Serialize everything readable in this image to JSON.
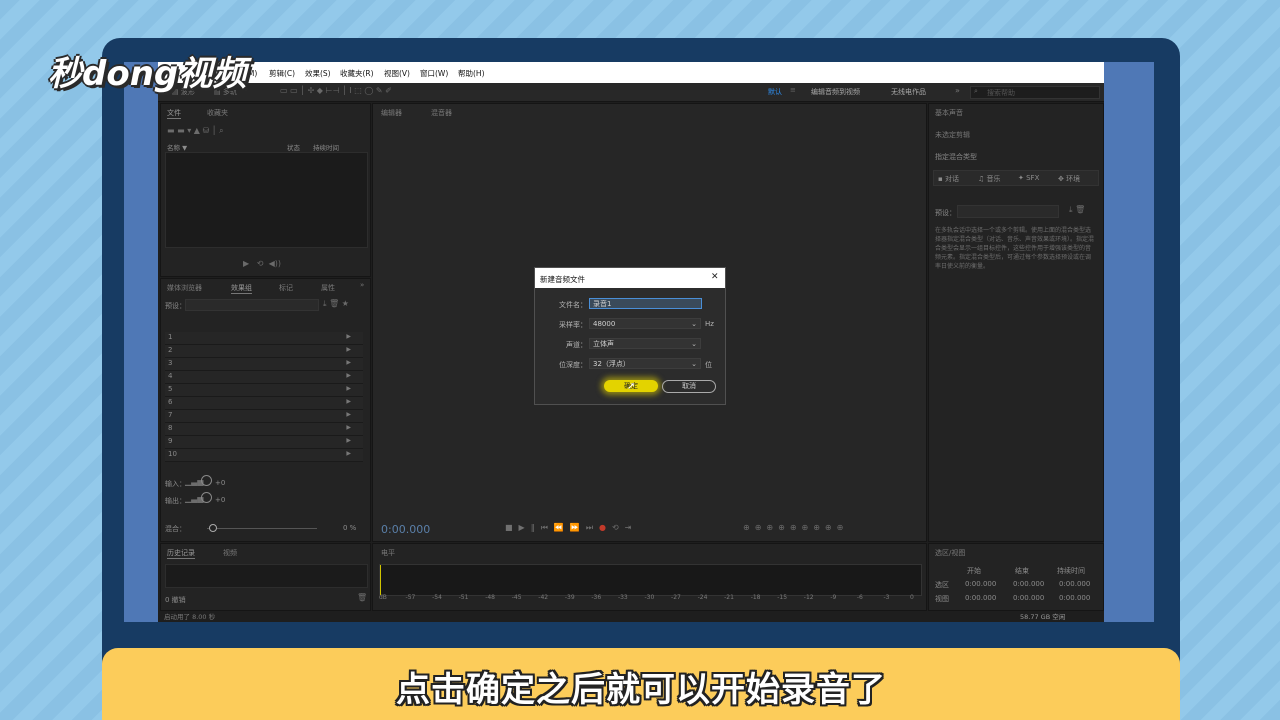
{
  "logo": {
    "text": "秒dong视频"
  },
  "caption": {
    "text": "点击确定之后就可以开始录音了"
  },
  "menubar": {
    "items": [
      "多轨(M)",
      "剪辑(C)",
      "效果(S)",
      "收藏夹(R)",
      "视图(V)",
      "窗口(W)",
      "帮助(H)"
    ]
  },
  "toolbar": {
    "waveform": "波形",
    "multitrack": "多轨",
    "workspaces": [
      "默认",
      "编辑音频到视频",
      "无线电作品"
    ],
    "search_placeholder": "搜索帮助"
  },
  "files_panel": {
    "tabs": [
      "文件",
      "收藏夹"
    ],
    "columns": [
      "名称 ▼",
      "状态",
      "持续时间"
    ]
  },
  "mixer_panel": {
    "tabs": [
      "媒体浏览器",
      "效果组",
      "标记",
      "属性"
    ],
    "preset_label": "预设：",
    "rows": [
      "1",
      "2",
      "3",
      "4",
      "5",
      "6",
      "7",
      "8",
      "9",
      "10"
    ],
    "input_label": "输入：",
    "output_label": "输出：",
    "input_value": "+0",
    "output_value": "+0",
    "mix_label": "混合：",
    "mix_value": "0 %"
  },
  "history_panel": {
    "tabs": [
      "历史记录",
      "视频"
    ],
    "undo": "0 撤销",
    "status": "启动用了 8.00 秒"
  },
  "editor": {
    "tabs": [
      "编辑器",
      "混音器"
    ],
    "time": "0:00.000"
  },
  "levels": {
    "tab": "电平",
    "scale": [
      "dB",
      "-57",
      "-54",
      "-51",
      "-48",
      "-45",
      "-42",
      "-39",
      "-36",
      "-33",
      "-30",
      "-27",
      "-24",
      "-21",
      "-18",
      "-15",
      "-12",
      "-9",
      "-6",
      "-3",
      "0"
    ]
  },
  "essential_sound": {
    "title": "基本声音",
    "no_selection": "未选定剪辑",
    "assign_type": "指定混合类型",
    "types": [
      "对话",
      "音乐",
      "SFX",
      "环境"
    ],
    "preset_label": "预设：",
    "description": "在多轨会话中选择一个或多个剪辑。使用上面的混合类型选择器指定混合类型（对话、音乐、声音效果或环境）。指定混合类型会显示一组目标控件，这些控件用于增强该类型的音频元素。指定混合类型后，可通过每个参数选择预设或在调率日使义前的衡量。"
  },
  "selection_panel": {
    "title": "选区/视图",
    "columns": [
      "开始",
      "结束",
      "持续时间"
    ],
    "rows": [
      {
        "label": "选区",
        "values": [
          "0:00.000",
          "0:00.000",
          "0:00.000"
        ]
      },
      {
        "label": "视图",
        "values": [
          "0:00.000",
          "0:00.000",
          "0:00.000"
        ]
      }
    ],
    "disk_space": "58.77 GB 空闲"
  },
  "dialog": {
    "title": "新建音频文件",
    "filename_label": "文件名：",
    "filename_value": "录音1",
    "samplerate_label": "采样率：",
    "samplerate_value": "48000",
    "samplerate_unit": "Hz",
    "channels_label": "声道：",
    "channels_value": "立体声",
    "bitdepth_label": "位深度：",
    "bitdepth_value": "32（浮点）",
    "bitdepth_unit": "位",
    "ok_label": "确定",
    "cancel_label": "取消",
    "close_glyph": "✕"
  },
  "colors": {
    "accent_blue": "#2f8ff0",
    "ok_highlight": "#e3d300",
    "caption_bar": "#fccc5a"
  }
}
